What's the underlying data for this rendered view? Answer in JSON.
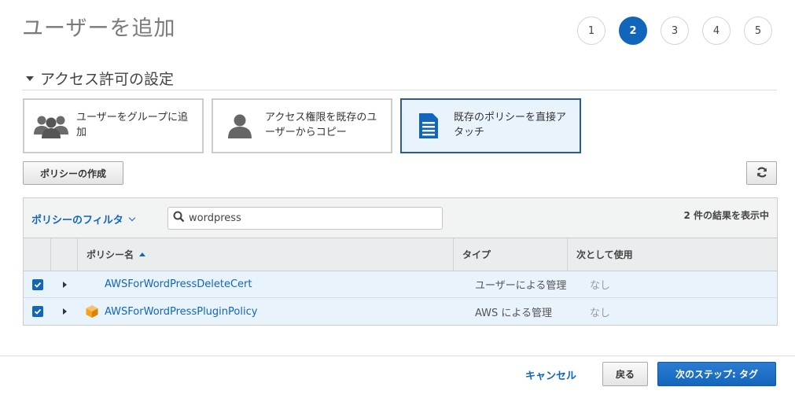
{
  "page": {
    "title": "ユーザーを追加"
  },
  "steps": [
    {
      "label": "1",
      "active": false
    },
    {
      "label": "2",
      "active": true
    },
    {
      "label": "3",
      "active": false
    },
    {
      "label": "4",
      "active": false
    },
    {
      "label": "5",
      "active": false
    }
  ],
  "permissions": {
    "section_title": "アクセス許可の設定",
    "options": [
      {
        "label": "ユーザーをグループに追加",
        "icon": "group-icon",
        "selected": false
      },
      {
        "label": "アクセス権限を既存のユーザーからコピー",
        "icon": "user-icon",
        "selected": false
      },
      {
        "label": "既存のポリシーを直接アタッチ",
        "icon": "document-icon",
        "selected": true
      }
    ]
  },
  "toolbar": {
    "create_policy_label": "ポリシーの作成",
    "refresh_icon": "refresh-icon"
  },
  "policy_table": {
    "filter_label": "ポリシーのフィルタ",
    "search_value": "wordpress",
    "result_count": "2 件の結果を表示中",
    "columns": {
      "name": "ポリシー名",
      "type": "タイプ",
      "used_as": "次として使用"
    },
    "rows": [
      {
        "checked": true,
        "name": "AWSForWordPressDeleteCert",
        "type": "ユーザーによる管理",
        "used_as": "なし",
        "aws_icon": false
      },
      {
        "checked": true,
        "name": "AWSForWordPressPluginPolicy",
        "type": "AWS による管理",
        "used_as": "なし",
        "aws_icon": true
      }
    ]
  },
  "footer": {
    "cancel_label": "キャンセル",
    "back_label": "戻る",
    "next_label": "次のステップ: タグ"
  },
  "colors": {
    "accent": "#1166bb",
    "selected_bg": "#e9f3fc",
    "aws_orange": "#f7a21b"
  }
}
